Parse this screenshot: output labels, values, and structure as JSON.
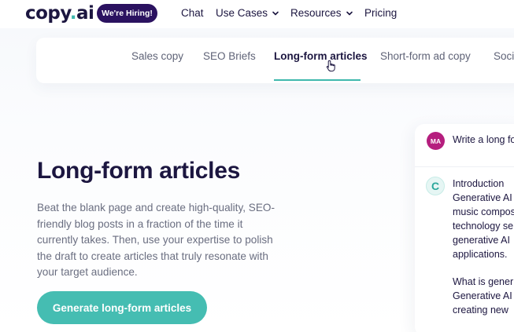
{
  "header": {
    "logo_text": "copy",
    "logo_dot": ".",
    "logo_suffix": "ai",
    "hiring_badge": "We're Hiring!",
    "nav": [
      {
        "label": "Chat",
        "has_dropdown": false
      },
      {
        "label": "Use Cases",
        "has_dropdown": true
      },
      {
        "label": "Resources",
        "has_dropdown": true
      },
      {
        "label": "Pricing",
        "has_dropdown": false
      }
    ]
  },
  "tabs": [
    {
      "label": "Sales copy",
      "active": false
    },
    {
      "label": "SEO Briefs",
      "active": false
    },
    {
      "label": "Long-form articles",
      "active": true
    },
    {
      "label": "Short-form ad copy",
      "active": false
    },
    {
      "label": "Soci",
      "active": false
    }
  ],
  "hero": {
    "title": "Long-form articles",
    "description": "Beat the blank page and create high-quality, SEO-friendly blog posts in a fraction of the time it currently takes. Then, use your expertise to polish the draft to create articles that truly resonate with your target audience.",
    "cta_label": "Generate long-form articles"
  },
  "chat_preview": {
    "user_initials": "MA",
    "user_prompt": "Write a long fo",
    "assistant_initial": "C",
    "response_lines": [
      "Introduction",
      "Generative AI",
      "music compos",
      "technology se",
      "generative AI",
      "applications.",
      "",
      "What is gener",
      "Generative AI",
      "creating new"
    ]
  },
  "colors": {
    "brand_dark": "#1c1640",
    "accent_teal": "#45bdb2",
    "hiring_badge_bg": "#2b1260",
    "user_avatar_bg": "#b51e7e"
  }
}
